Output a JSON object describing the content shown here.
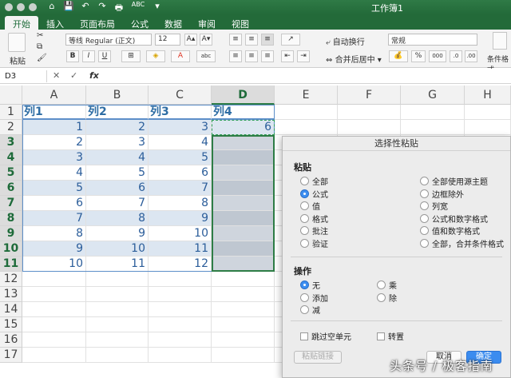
{
  "window": {
    "title": "工作簿1"
  },
  "quick_access": [
    "⌂",
    "💾",
    "↶",
    "↷",
    "🖶",
    "ABC",
    "▾"
  ],
  "tabs": [
    {
      "label": "开始",
      "active": true
    },
    {
      "label": "插入"
    },
    {
      "label": "页面布局"
    },
    {
      "label": "公式"
    },
    {
      "label": "数据"
    },
    {
      "label": "审阅"
    },
    {
      "label": "视图"
    }
  ],
  "ribbon": {
    "paste": "粘贴",
    "font_name": "等线 Regular (正文)",
    "font_size": "12",
    "bold": "B",
    "italic": "I",
    "underline": "U",
    "wrap_text": "自动换行",
    "merge_center": "合并后居中",
    "number_format": "常规",
    "percent": "%",
    "comma": "000",
    "conditional_format": "条件格式"
  },
  "formula_bar": {
    "name_box": "D3",
    "fx": "fx",
    "value": ""
  },
  "columns": [
    "A",
    "B",
    "C",
    "D",
    "E",
    "F",
    "G",
    "H"
  ],
  "rows": [
    "1",
    "2",
    "3",
    "4",
    "5",
    "6",
    "7",
    "8",
    "9",
    "10",
    "11",
    "12",
    "13",
    "14",
    "15",
    "16",
    "17"
  ],
  "headers": [
    "列1",
    "列2",
    "列3",
    "列4"
  ],
  "data": [
    [
      1,
      2,
      3,
      6
    ],
    [
      2,
      3,
      4
    ],
    [
      3,
      4,
      5
    ],
    [
      4,
      5,
      6
    ],
    [
      5,
      6,
      7
    ],
    [
      6,
      7,
      8
    ],
    [
      7,
      8,
      9
    ],
    [
      8,
      9,
      10
    ],
    [
      9,
      10,
      11
    ],
    [
      10,
      11,
      12
    ]
  ],
  "dialog": {
    "title": "选择性粘贴",
    "paste_section": "粘贴",
    "paste_left": [
      "全部",
      "公式",
      "值",
      "格式",
      "批注",
      "验证"
    ],
    "paste_right": [
      "全部使用源主题",
      "边框除外",
      "列宽",
      "公式和数字格式",
      "值和数字格式",
      "全部，合并条件格式"
    ],
    "paste_selected": "公式",
    "operation_section": "操作",
    "operation_left": [
      "无",
      "添加",
      "减"
    ],
    "operation_right": [
      "乘",
      "除"
    ],
    "operation_selected": "无",
    "skip_blanks": "跳过空单元",
    "transpose": "转置",
    "paste_link": "粘贴链接",
    "cancel": "取消",
    "ok": "确定"
  },
  "watermark": "头条号 / 极客指南",
  "colors": {
    "green": "#236a39",
    "band": "#dce6f1",
    "blue_text": "#2b5d9a",
    "ok": "#3b8cef"
  }
}
